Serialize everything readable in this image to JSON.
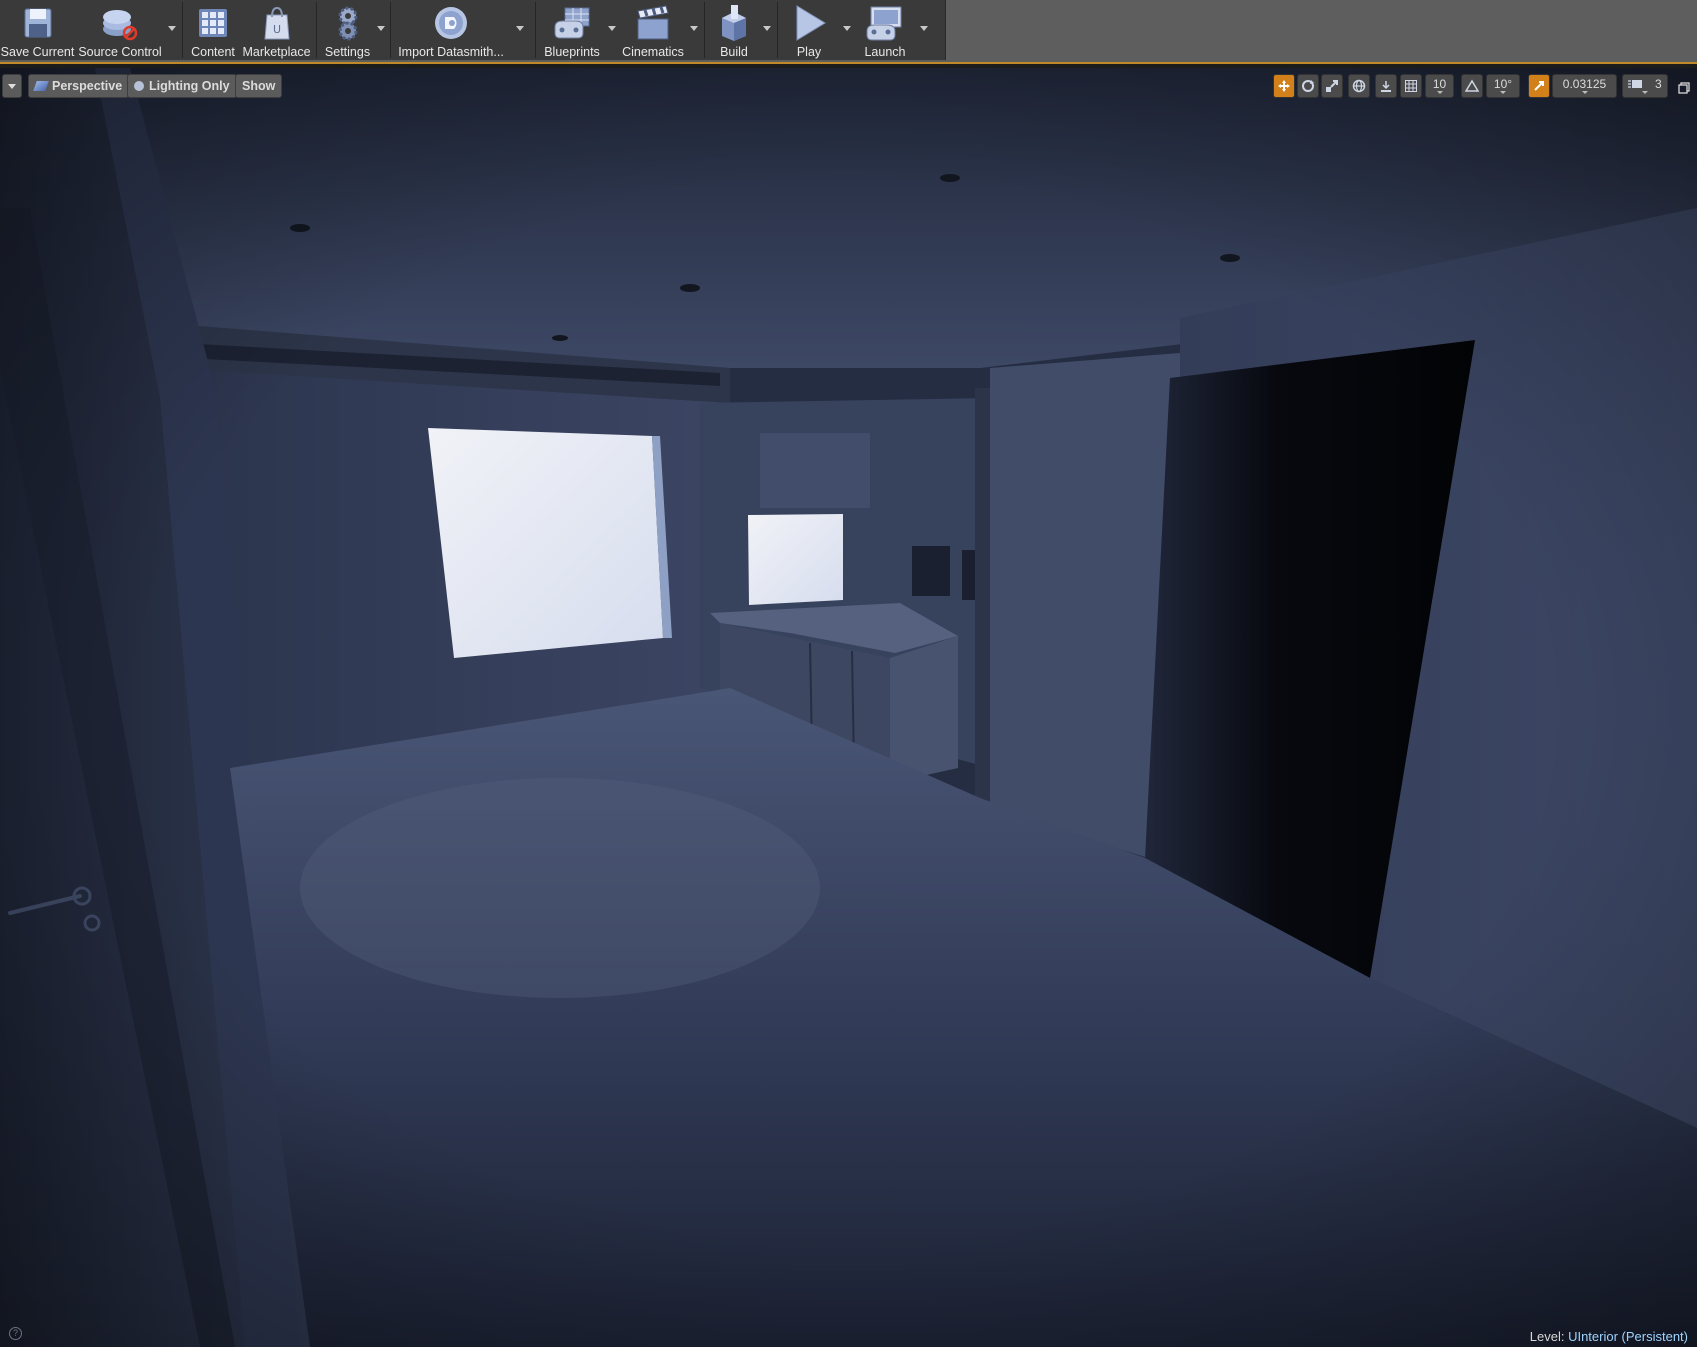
{
  "toolbar": {
    "buttons": [
      {
        "id": "save",
        "label": "Save Current",
        "icon": "save-icon"
      },
      {
        "id": "source",
        "label": "Source Control",
        "icon": "source-control-icon"
      },
      {
        "id": "content",
        "label": "Content",
        "icon": "content-browser-icon"
      },
      {
        "id": "marketplace",
        "label": "Marketplace",
        "icon": "marketplace-icon"
      },
      {
        "id": "settings",
        "label": "Settings",
        "icon": "settings-icon"
      },
      {
        "id": "datasmith",
        "label": "Import Datasmith...",
        "icon": "datasmith-icon"
      },
      {
        "id": "blueprints",
        "label": "Blueprints",
        "icon": "blueprints-icon"
      },
      {
        "id": "cinematics",
        "label": "Cinematics",
        "icon": "cinematics-icon"
      },
      {
        "id": "build",
        "label": "Build",
        "icon": "build-icon"
      },
      {
        "id": "play",
        "label": "Play",
        "icon": "play-icon"
      },
      {
        "id": "launch",
        "label": "Launch",
        "icon": "launch-icon"
      }
    ]
  },
  "viewport": {
    "view_mode": "Perspective",
    "lighting_mode": "Lighting Only",
    "show_label": "Show",
    "grid_snap_value": "10",
    "rotation_snap_value": "10°",
    "scale_snap_value": "0.03125",
    "camera_speed_value": "3",
    "status": {
      "level_label": "Level:",
      "level_name": "UInterior (Persistent)"
    }
  },
  "colors": {
    "toolbar_bg": "#3a3a3a",
    "toolbar_accent": "#c08a28",
    "active_orange": "#d1801a",
    "scene_tint": "#3c4866",
    "window_light": "#e6eaf4",
    "level_name": "#9ed3ff"
  }
}
